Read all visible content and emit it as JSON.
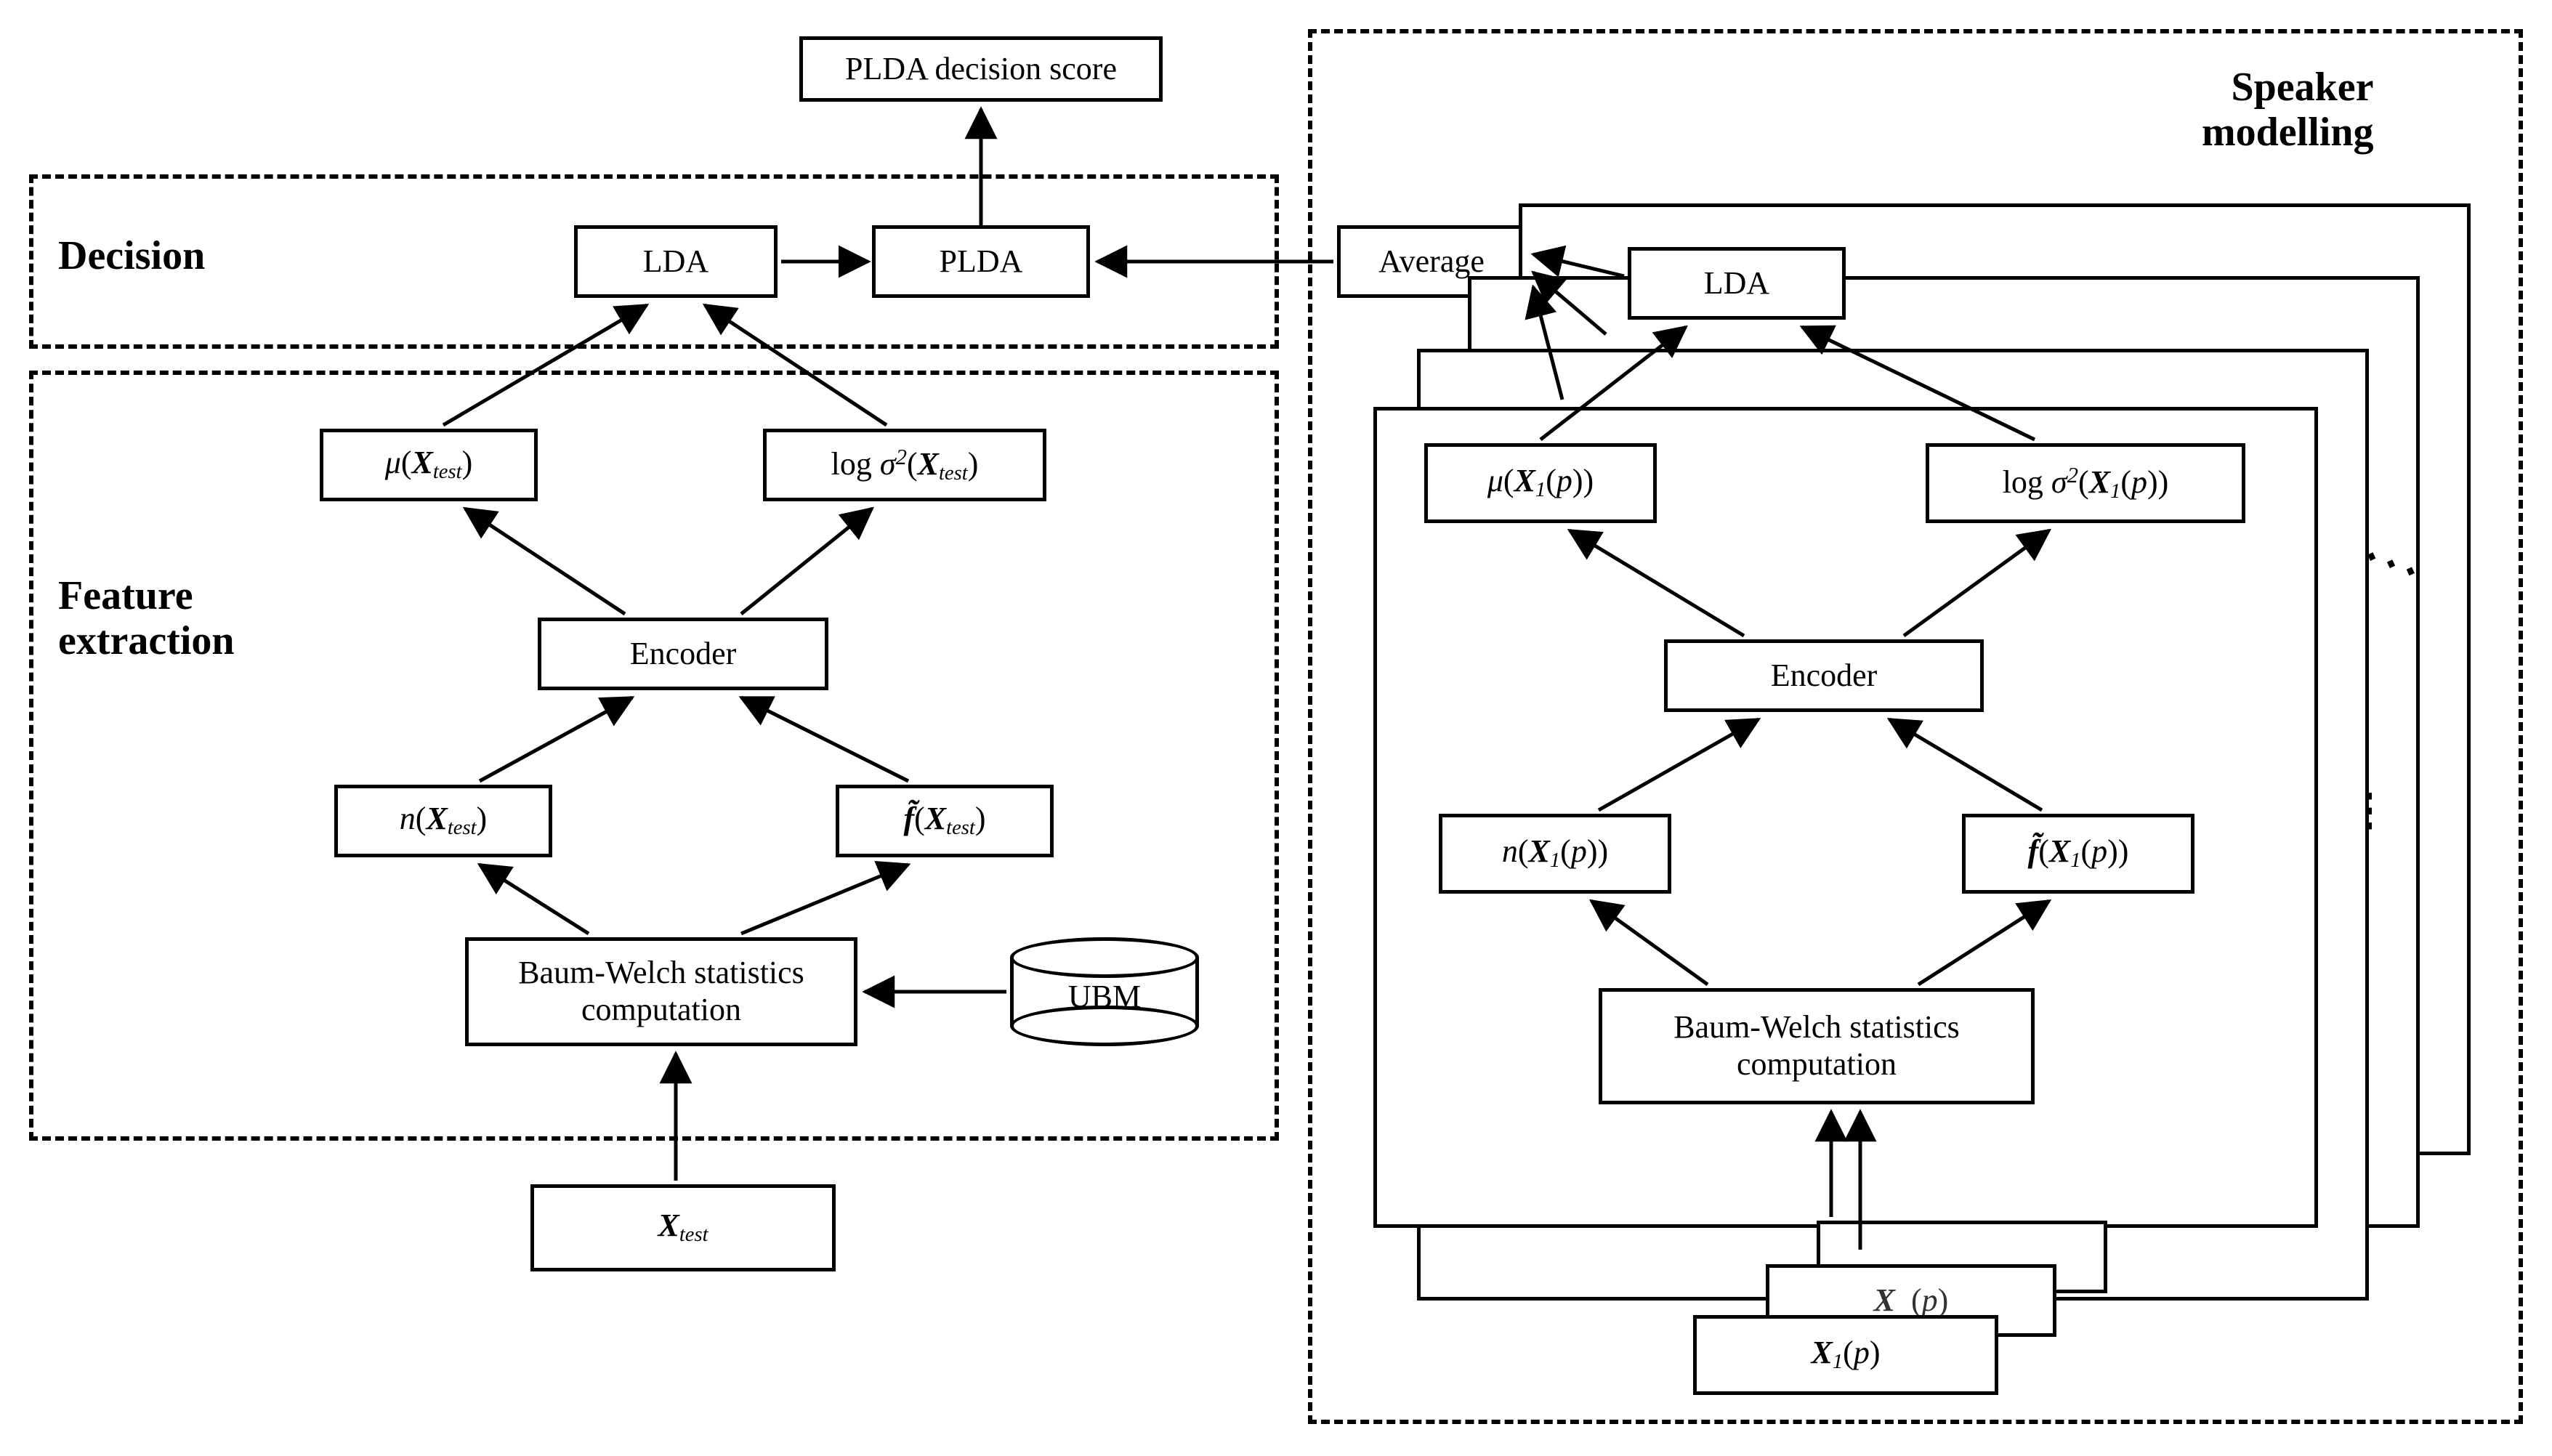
{
  "regions": {
    "decision": "Decision",
    "feature_extraction_l1": "Feature",
    "feature_extraction_l2": "extraction",
    "speaker_modelling_l1": "Speaker",
    "speaker_modelling_l2": "modelling"
  },
  "top": {
    "plda_score": "PLDA decision score",
    "lda": "LDA",
    "plda": "PLDA",
    "average": "Average"
  },
  "left": {
    "mu": "μ(𝐗_test)",
    "logsig": "log σ²(𝐗_test)",
    "encoder": "Encoder",
    "n": "n(𝐗_test)",
    "f": "f̃(𝐗_test)",
    "bw_l1": "Baum-Welch statistics",
    "bw_l2": "computation",
    "ubm": "UBM",
    "xtest": "𝐗_test"
  },
  "right": {
    "lda": "LDA",
    "mu": "μ(𝐗₁(p))",
    "logsig": "log σ²(𝐗₁(p))",
    "encoder": "Encoder",
    "n": "n(𝐗₁(p))",
    "f": "f̃(𝐗₁(p))",
    "bw_l1": "Baum-Welch statistics",
    "bw_l2": "computation",
    "x1": "𝐗₁(p)",
    "x_hidden": "𝐗 (p)"
  }
}
